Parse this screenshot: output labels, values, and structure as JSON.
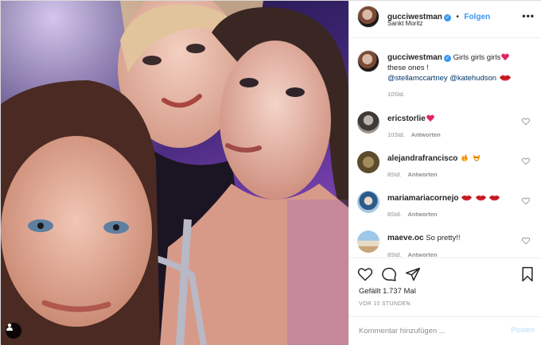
{
  "post": {
    "owner": {
      "username": "gucciwestman",
      "verified_icon": "verified-badge-icon",
      "follow_label": "Folgen",
      "location": "Sankt Moritz"
    },
    "caption": {
      "username": "gucciwestman",
      "text_before": "Girls girls girls",
      "text_after": "these ones !",
      "mention_1": "@stellamccartney",
      "mention_2": "@katehudson",
      "time": "10Std."
    },
    "comments": [
      {
        "username": "ericstorlie",
        "text": "",
        "time": "10Std.",
        "reply_label": "Antworten",
        "emoji": [
          "heart"
        ]
      },
      {
        "username": "alejandrafrancisco",
        "text": "",
        "time": "8Std.",
        "reply_label": "Antworten",
        "emoji": [
          "fire",
          "fox"
        ]
      },
      {
        "username": "mariamariacornejo",
        "text": "",
        "time": "8Std.",
        "reply_label": "Antworten",
        "emoji": [
          "lips",
          "lips",
          "lips"
        ]
      },
      {
        "username": "maeve.oc",
        "text": "So pretty!!",
        "time": "8Std.",
        "reply_label": "Antworten",
        "emoji": []
      }
    ],
    "likes_text": "Gefällt 1.737 Mal",
    "posted_ago": "VOR 10 STUNDEN",
    "comment_placeholder": "Kommentar hinzufügen ...",
    "post_label": "Posten"
  },
  "colors": {
    "accent": "#3897f0",
    "post_disabled": "#b2dffc",
    "muted": "#8e8e8e",
    "heart_emoji": "#e0245e"
  }
}
